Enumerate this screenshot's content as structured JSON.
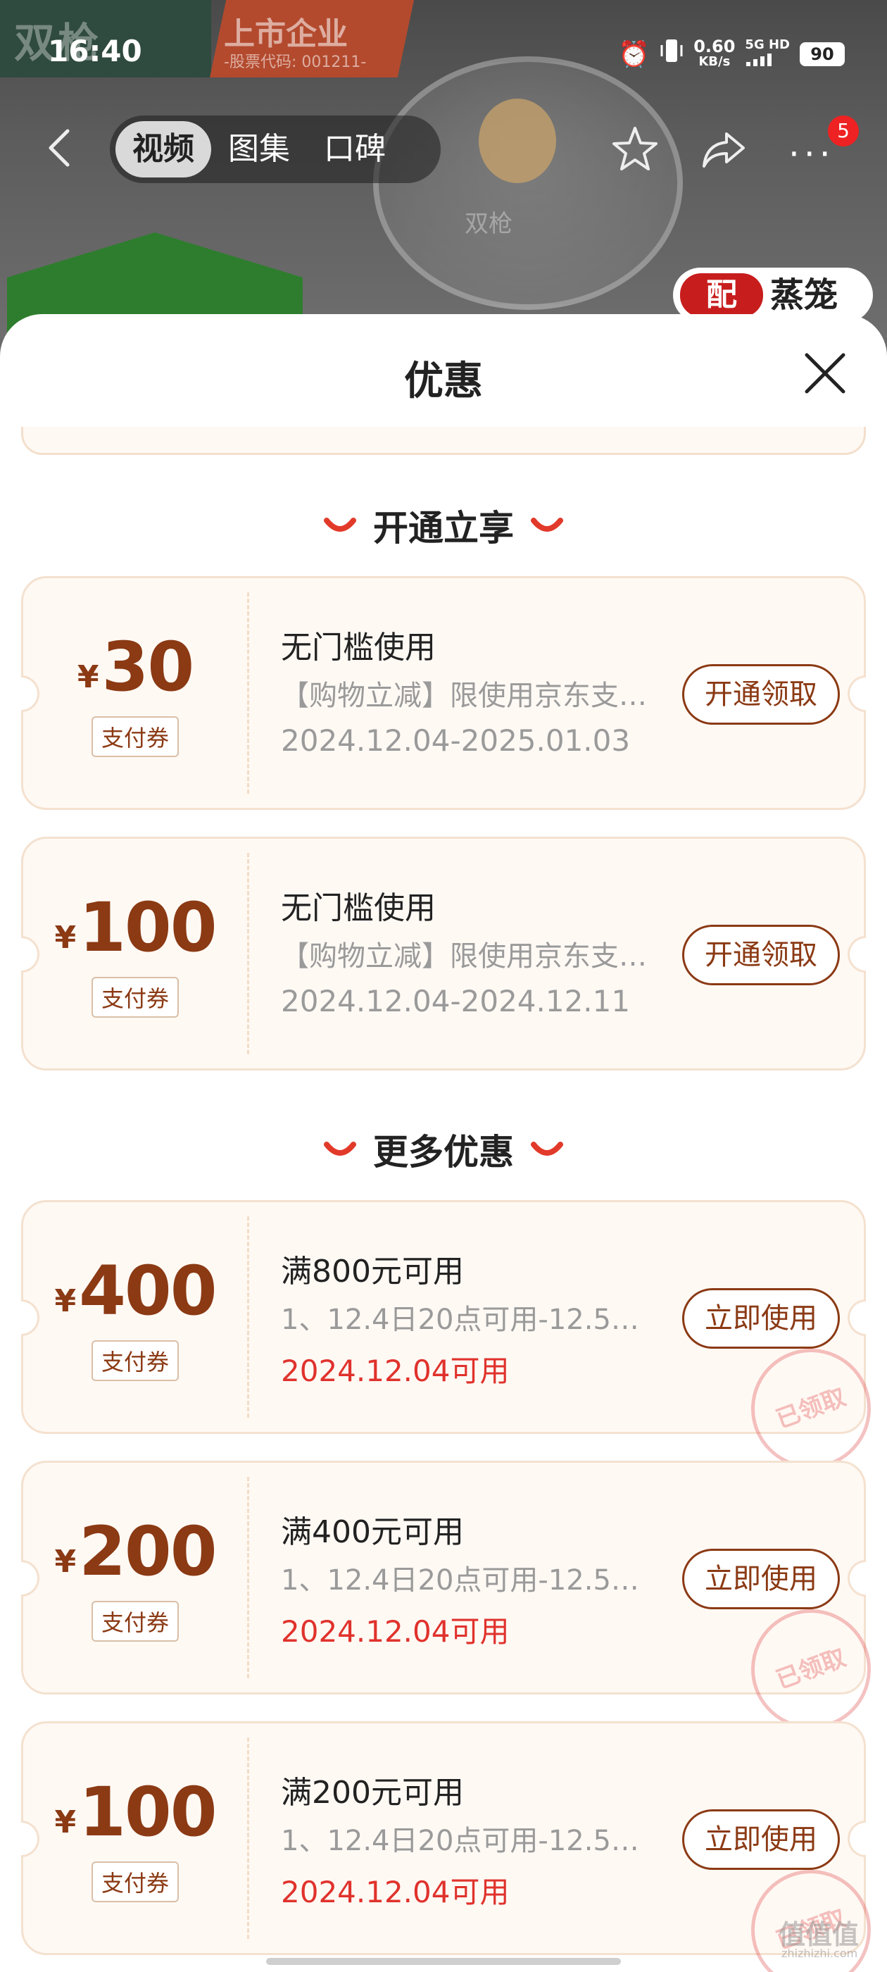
{
  "status_bar": {
    "time": "16:40",
    "net_speed_value": "0.60",
    "net_speed_unit": "KB/s",
    "net_type": "5G HD",
    "battery": "90"
  },
  "product_banner": {
    "brand": "双枪",
    "listed_title": "上市企业",
    "listed_sub": "-股票代码: 001211-",
    "pot_mark": "双枪",
    "steam_badge": "配",
    "steam_label": "蒸笼"
  },
  "nav": {
    "tabs": [
      {
        "label": "视频",
        "active": true
      },
      {
        "label": "图集",
        "active": false
      },
      {
        "label": "口碑",
        "active": false
      }
    ],
    "more_badge": "5"
  },
  "sheet": {
    "title": "优惠"
  },
  "sections": [
    {
      "title": "开通立享"
    },
    {
      "title": "更多优惠"
    }
  ],
  "coupons": [
    {
      "currency": "¥",
      "amount": "30",
      "tag": "支付券",
      "title": "无门槛使用",
      "desc": "【购物立减】限使用京东支…",
      "date": "2024.12.04-2025.01.03",
      "date_style": "gray",
      "button": "开通领取",
      "claimed": false
    },
    {
      "currency": "¥",
      "amount": "100",
      "tag": "支付券",
      "title": "无门槛使用",
      "desc": "【购物立减】限使用京东支…",
      "date": "2024.12.04-2024.12.11",
      "date_style": "gray",
      "button": "开通领取",
      "claimed": false
    },
    {
      "currency": "¥",
      "amount": "400",
      "tag": "支付券",
      "title": "满800元可用",
      "desc": "1、12.4日20点可用-12.5…",
      "date": "2024.12.04可用",
      "date_style": "red",
      "button": "立即使用",
      "claimed": true,
      "stamp": "已领取"
    },
    {
      "currency": "¥",
      "amount": "200",
      "tag": "支付券",
      "title": "满400元可用",
      "desc": "1、12.4日20点可用-12.5…",
      "date": "2024.12.04可用",
      "date_style": "red",
      "button": "立即使用",
      "claimed": true,
      "stamp": "已领取"
    },
    {
      "currency": "¥",
      "amount": "100",
      "tag": "支付券",
      "title": "满200元可用",
      "desc": "1、12.4日20点可用-12.5…",
      "date": "2024.12.04可用",
      "date_style": "red",
      "button": "立即使用",
      "claimed": true,
      "stamp": "已领取"
    }
  ],
  "watermark": {
    "main": "值值值",
    "sub": "zhizhizhi.com"
  },
  "colors": {
    "accent_brown": "#8b3a14",
    "date_red": "#e0322c",
    "card_bg": "#fff9f4",
    "smile_red": "#e23a2a"
  }
}
